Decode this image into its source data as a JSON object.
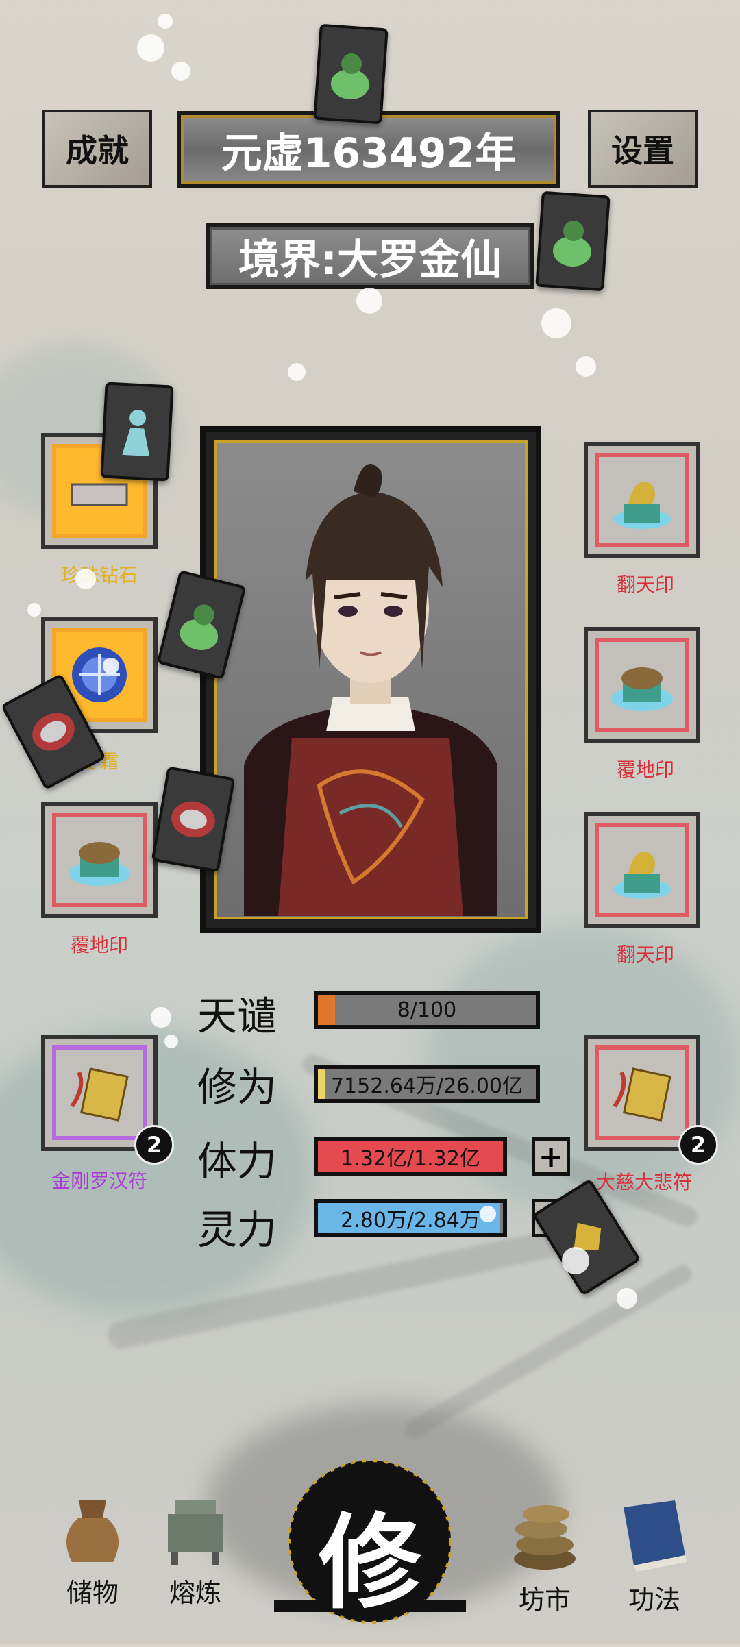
{
  "header": {
    "achievement_label": "成就",
    "year_label": "元虚163492年",
    "settings_label": "设置"
  },
  "realm": {
    "label": "境界:大罗金仙"
  },
  "left_slots": [
    {
      "name": "珍珠钻石",
      "label_color": "#e3b21f",
      "frame_color": "#f3a62a"
    },
    {
      "name": "冬霜",
      "label_color": "#e3b21f",
      "frame_color": "#f3a62a"
    },
    {
      "name": "覆地印",
      "label_color": "#d8303a",
      "frame_color": "#e05a63"
    }
  ],
  "right_slots": [
    {
      "name": "翻天印",
      "label_color": "#d8303a",
      "frame_color": "#e05a63"
    },
    {
      "name": "覆地印",
      "label_color": "#d8303a",
      "frame_color": "#e05a63"
    },
    {
      "name": "翻天印",
      "label_color": "#d8303a",
      "frame_color": "#e05a63"
    }
  ],
  "talismans": {
    "left": {
      "name": "金刚罗汉符",
      "count": "2",
      "label_color": "#a93bd6",
      "frame_color": "#b86be0"
    },
    "right": {
      "name": "大慈大悲符",
      "count": "2",
      "label_color": "#d8303a",
      "frame_color": "#e05a63"
    }
  },
  "stats": {
    "tianqian": {
      "label": "天谴",
      "value": "8/100",
      "fraction": 0.08,
      "color": "#e0762b"
    },
    "xiuwei": {
      "label": "修为",
      "value": "7152.64万/26.00亿",
      "fraction": 0.03,
      "color": "#e8d46a"
    },
    "tili": {
      "label": "体力",
      "value": "1.32亿/1.32亿",
      "fraction": 1.0,
      "color": "#e44a4f"
    },
    "lingli": {
      "label": "灵力",
      "value": "2.80万/2.84万",
      "fraction": 0.985,
      "color": "#6bb6e8"
    }
  },
  "nav": {
    "storage": "储物",
    "smelt": "熔炼",
    "cultivate": "修",
    "market": "坊市",
    "skills": "功法"
  }
}
